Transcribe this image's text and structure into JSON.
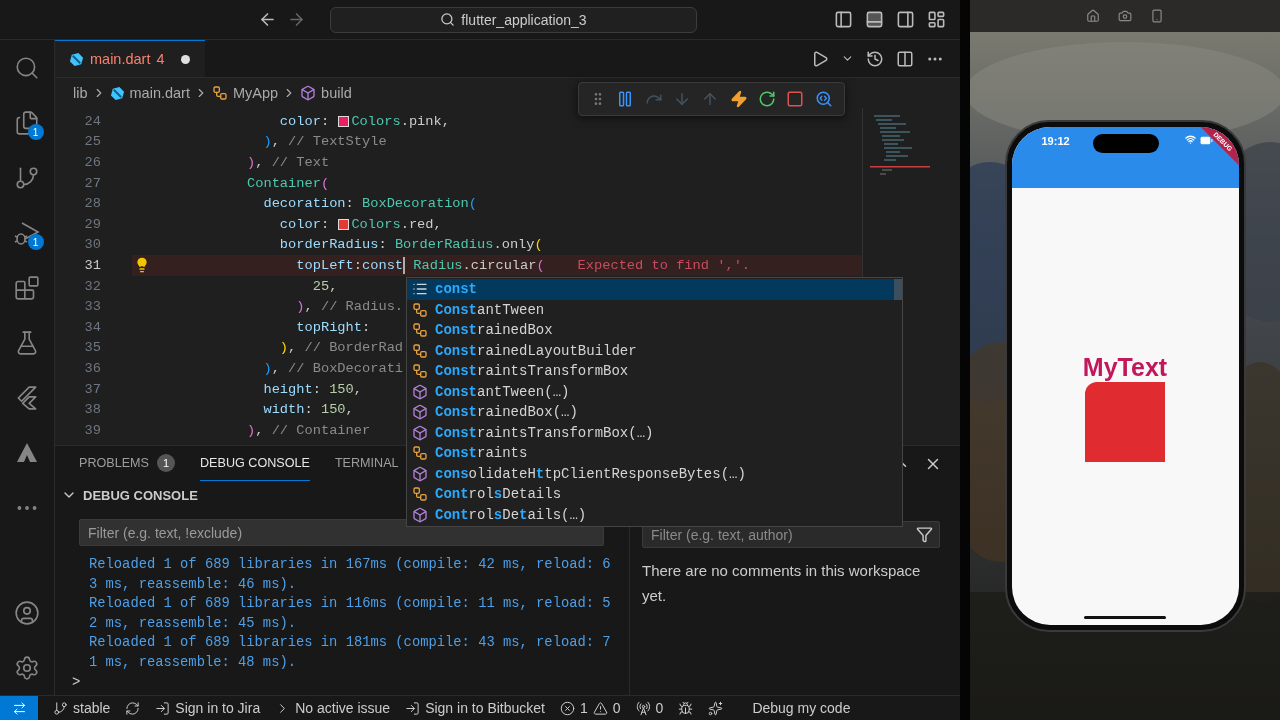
{
  "title_bar": {
    "search": "flutter_application_3"
  },
  "activity_bar": {
    "top_items": [
      {
        "kind": "search"
      },
      {
        "kind": "explorer",
        "badge": "1"
      },
      {
        "kind": "source_control"
      },
      {
        "kind": "run_debug",
        "badge": "1"
      },
      {
        "kind": "extensions"
      },
      {
        "kind": "testing"
      },
      {
        "kind": "flutter"
      },
      {
        "kind": "atlassian"
      },
      {
        "kind": "more"
      }
    ],
    "bottom_items": [
      {
        "kind": "account"
      },
      {
        "kind": "settings"
      }
    ]
  },
  "editor": {
    "tabs": [
      {
        "label": "main.dart",
        "problems": "4",
        "dirty": true,
        "selected": true
      }
    ],
    "breadcrumbs": [
      {
        "kind": "folder",
        "label": "lib"
      },
      {
        "kind": "dart",
        "label": "main.dart"
      },
      {
        "kind": "class",
        "label": "MyApp"
      },
      {
        "kind": "method",
        "label": "build"
      }
    ],
    "lines": [
      {
        "number": "24",
        "current": false,
        "error": false,
        "lightbulb": false,
        "tokens": [
          {
            "text": "                  color",
            "kind": "prop"
          },
          {
            "text": ": ",
            "kind": "plain"
          },
          {
            "kind": "swatch",
            "color": "#e91e63"
          },
          {
            "text": "Colors",
            "kind": "type"
          },
          {
            "text": ".pink,",
            "kind": "plain"
          }
        ]
      },
      {
        "number": "25",
        "current": false,
        "error": false,
        "lightbulb": false,
        "tokens": [
          {
            "text": "                )",
            "kind": "bracket3"
          },
          {
            "text": ", ",
            "kind": "plain"
          },
          {
            "text": "// TextStyle",
            "kind": "comment"
          }
        ]
      },
      {
        "number": "26",
        "current": false,
        "error": false,
        "lightbulb": false,
        "tokens": [
          {
            "text": "              )",
            "kind": "bracket2"
          },
          {
            "text": ", ",
            "kind": "plain"
          },
          {
            "text": "// Text",
            "kind": "comment"
          }
        ]
      },
      {
        "number": "27",
        "current": false,
        "error": false,
        "lightbulb": false,
        "tokens": [
          {
            "text": "              Container",
            "kind": "type"
          },
          {
            "text": "(",
            "kind": "bracket2"
          }
        ]
      },
      {
        "number": "28",
        "current": false,
        "error": false,
        "lightbulb": false,
        "tokens": [
          {
            "text": "                decoration",
            "kind": "prop"
          },
          {
            "text": ": ",
            "kind": "plain"
          },
          {
            "text": "BoxDecoration",
            "kind": "type"
          },
          {
            "text": "(",
            "kind": "bracket3"
          }
        ]
      },
      {
        "number": "29",
        "current": false,
        "error": false,
        "lightbulb": false,
        "tokens": [
          {
            "text": "                  color",
            "kind": "prop"
          },
          {
            "text": ": ",
            "kind": "plain"
          },
          {
            "kind": "swatch",
            "color": "#e53935"
          },
          {
            "text": "Colors",
            "kind": "type"
          },
          {
            "text": ".red,",
            "kind": "plain"
          }
        ]
      },
      {
        "number": "30",
        "current": false,
        "error": false,
        "lightbulb": false,
        "tokens": [
          {
            "text": "                  borderRadius",
            "kind": "prop"
          },
          {
            "text": ": ",
            "kind": "plain"
          },
          {
            "text": "BorderRadius",
            "kind": "type"
          },
          {
            "text": ".only",
            "kind": "plain"
          },
          {
            "text": "(",
            "kind": "bracket1"
          }
        ]
      },
      {
        "number": "31",
        "current": true,
        "error": true,
        "lightbulb": true,
        "message": "Expected to find ','.",
        "tokens": [
          {
            "text": "                    topLeft",
            "kind": "prop"
          },
          {
            "text": ":",
            "kind": "plain"
          },
          {
            "text": "const",
            "kind": "keyword"
          },
          {
            "kind": "caret"
          },
          {
            "text": " Radius",
            "kind": "type"
          },
          {
            "text": ".circular",
            "kind": "plain"
          },
          {
            "text": "(",
            "kind": "bracket2"
          }
        ]
      },
      {
        "number": "32",
        "current": false,
        "error": false,
        "lightbulb": false,
        "tokens": [
          {
            "text": "                      25",
            "kind": "number"
          },
          {
            "text": ",",
            "kind": "plain"
          }
        ]
      },
      {
        "number": "33",
        "current": false,
        "error": false,
        "lightbulb": false,
        "tokens": [
          {
            "text": "                    )",
            "kind": "bracket2"
          },
          {
            "text": ", ",
            "kind": "plain"
          },
          {
            "text": "// Radius.",
            "kind": "comment"
          }
        ]
      },
      {
        "number": "34",
        "current": false,
        "error": false,
        "lightbulb": false,
        "tokens": [
          {
            "text": "                    topRight",
            "kind": "prop"
          },
          {
            "text": ":",
            "kind": "plain"
          }
        ]
      },
      {
        "number": "35",
        "current": false,
        "error": false,
        "lightbulb": false,
        "tokens": [
          {
            "text": "                  )",
            "kind": "bracket1"
          },
          {
            "text": ", ",
            "kind": "plain"
          },
          {
            "text": "// BorderRad",
            "kind": "comment"
          }
        ]
      },
      {
        "number": "36",
        "current": false,
        "error": false,
        "lightbulb": false,
        "tokens": [
          {
            "text": "                )",
            "kind": "bracket3"
          },
          {
            "text": ", ",
            "kind": "plain"
          },
          {
            "text": "// BoxDecorati",
            "kind": "comment"
          }
        ]
      },
      {
        "number": "37",
        "current": false,
        "error": false,
        "lightbulb": false,
        "tokens": [
          {
            "text": "                height",
            "kind": "prop"
          },
          {
            "text": ": ",
            "kind": "plain"
          },
          {
            "text": "150",
            "kind": "number"
          },
          {
            "text": ",",
            "kind": "plain"
          }
        ]
      },
      {
        "number": "38",
        "current": false,
        "error": false,
        "lightbulb": false,
        "tokens": [
          {
            "text": "                width",
            "kind": "prop"
          },
          {
            "text": ": ",
            "kind": "plain"
          },
          {
            "text": "150",
            "kind": "number"
          },
          {
            "text": ",",
            "kind": "plain"
          }
        ]
      },
      {
        "number": "39",
        "current": false,
        "error": false,
        "lightbulb": false,
        "tokens": [
          {
            "text": "              )",
            "kind": "bracket2"
          },
          {
            "text": ", ",
            "kind": "plain"
          },
          {
            "text": "// Container",
            "kind": "comment"
          }
        ]
      }
    ]
  },
  "debug_toolbar": [
    {
      "kind": "pause",
      "disabled": false
    },
    {
      "kind": "step_over",
      "disabled": true
    },
    {
      "kind": "step_into",
      "disabled": true
    },
    {
      "kind": "step_out",
      "disabled": true
    },
    {
      "kind": "hot_reload",
      "disabled": false
    },
    {
      "kind": "restart",
      "disabled": false
    },
    {
      "kind": "stop",
      "disabled": false
    },
    {
      "kind": "devtools",
      "disabled": false
    }
  ],
  "suggestions": [
    {
      "kind": "keyword",
      "selected": true,
      "segments": [
        {
          "text": "const",
          "match": true
        }
      ]
    },
    {
      "kind": "class",
      "selected": false,
      "segments": [
        {
          "text": "Const",
          "match": true
        },
        {
          "text": "antTween",
          "match": false
        }
      ]
    },
    {
      "kind": "class",
      "selected": false,
      "segments": [
        {
          "text": "Const",
          "match": true
        },
        {
          "text": "rainedBox",
          "match": false
        }
      ]
    },
    {
      "kind": "class",
      "selected": false,
      "segments": [
        {
          "text": "Const",
          "match": true
        },
        {
          "text": "rainedLayoutBuilder",
          "match": false
        }
      ]
    },
    {
      "kind": "class",
      "selected": false,
      "segments": [
        {
          "text": "Const",
          "match": true
        },
        {
          "text": "raintsTransformBox",
          "match": false
        }
      ]
    },
    {
      "kind": "constructor",
      "selected": false,
      "segments": [
        {
          "text": "Const",
          "match": true
        },
        {
          "text": "antTween(…)",
          "match": false
        }
      ]
    },
    {
      "kind": "constructor",
      "selected": false,
      "segments": [
        {
          "text": "Const",
          "match": true
        },
        {
          "text": "rainedBox(…)",
          "match": false
        }
      ]
    },
    {
      "kind": "constructor",
      "selected": false,
      "segments": [
        {
          "text": "Const",
          "match": true
        },
        {
          "text": "raintsTransformBox(…)",
          "match": false
        }
      ]
    },
    {
      "kind": "class",
      "selected": false,
      "segments": [
        {
          "text": "Const",
          "match": true
        },
        {
          "text": "raints",
          "match": false
        }
      ]
    },
    {
      "kind": "constructor",
      "selected": false,
      "segments": [
        {
          "text": "cons",
          "match": true
        },
        {
          "text": "olidateH",
          "match": false
        },
        {
          "text": "t",
          "match": true
        },
        {
          "text": "tpClientResponseBytes(…)",
          "match": false
        }
      ]
    },
    {
      "kind": "class",
      "selected": false,
      "segments": [
        {
          "text": "Cont",
          "match": true
        },
        {
          "text": "rol",
          "match": false
        },
        {
          "text": "s",
          "match": true
        },
        {
          "text": "Details",
          "match": false
        }
      ]
    },
    {
      "kind": "constructor",
      "selected": false,
      "segments": [
        {
          "text": "Cont",
          "match": true
        },
        {
          "text": "rol",
          "match": false
        },
        {
          "text": "s",
          "match": true
        },
        {
          "text": "De",
          "match": false
        },
        {
          "text": "t",
          "match": true
        },
        {
          "text": "ails(…)",
          "match": false
        }
      ]
    }
  ],
  "panel": {
    "tabs": [
      {
        "label": "PROBLEMS",
        "badge": "1",
        "selected": false
      },
      {
        "label": "DEBUG CONSOLE",
        "selected": true
      },
      {
        "label": "TERMINAL",
        "selected": false
      }
    ],
    "section": "DEBUG CONSOLE",
    "filter_placeholder": "Filter (e.g. text, !exclude)",
    "output": [
      "Reloaded 1 of 689 libraries in 167ms (compile: 42 ms, reload: 63 ms, reassemble: 46 ms).",
      "Reloaded 1 of 689 libraries in 116ms (compile: 11 ms, reload: 52 ms, reassemble: 45 ms).",
      "Reloaded 1 of 689 libraries in 181ms (compile: 43 ms, reload: 71 ms, reassemble: 48 ms)."
    ],
    "prompt": ">",
    "comments": {
      "filter_placeholder": "Filter (e.g. text, author)",
      "empty_message": "There are no comments in this workspace yet."
    }
  },
  "status_bar": [
    {
      "kind": "remote"
    },
    {
      "kind": "branch",
      "label": "stable"
    },
    {
      "kind": "sign_in",
      "label": "Sign in to Jira"
    },
    {
      "kind": "issue",
      "label": "No active issue"
    },
    {
      "kind": "sign_in",
      "label": "Sign in to Bitbucket"
    },
    {
      "kind": "problems",
      "errors": "1",
      "warnings": "0"
    },
    {
      "kind": "ports",
      "label": "0"
    },
    {
      "kind": "debug_target"
    },
    {
      "kind": "sparkle"
    },
    {
      "kind": "text",
      "label": "Debug my code"
    }
  ],
  "simulator": {
    "time": "19:12",
    "debug_banner": "DEBUG",
    "text": "MyText"
  }
}
